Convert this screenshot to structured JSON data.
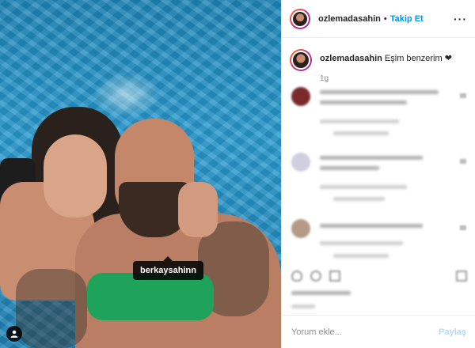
{
  "post": {
    "username": "ozlemadasahin",
    "follow_label": "Takip Et",
    "caption": "Eşim benzerim",
    "caption_emoji": "❤",
    "time_ago": "1g",
    "photo_tag": "berkaysahinn"
  },
  "comment_box": {
    "placeholder": "Yorum ekle...",
    "post_label": "Paylaş"
  },
  "icons": {
    "more": "more-options-icon",
    "user_tag": "user-tag-icon",
    "like": "heart-icon",
    "comment": "comment-icon",
    "share": "share-icon",
    "save": "bookmark-icon"
  },
  "colors": {
    "accent": "#0095f6",
    "post_disabled": "#b3dbff",
    "pool_water": "#2a9bd0"
  }
}
